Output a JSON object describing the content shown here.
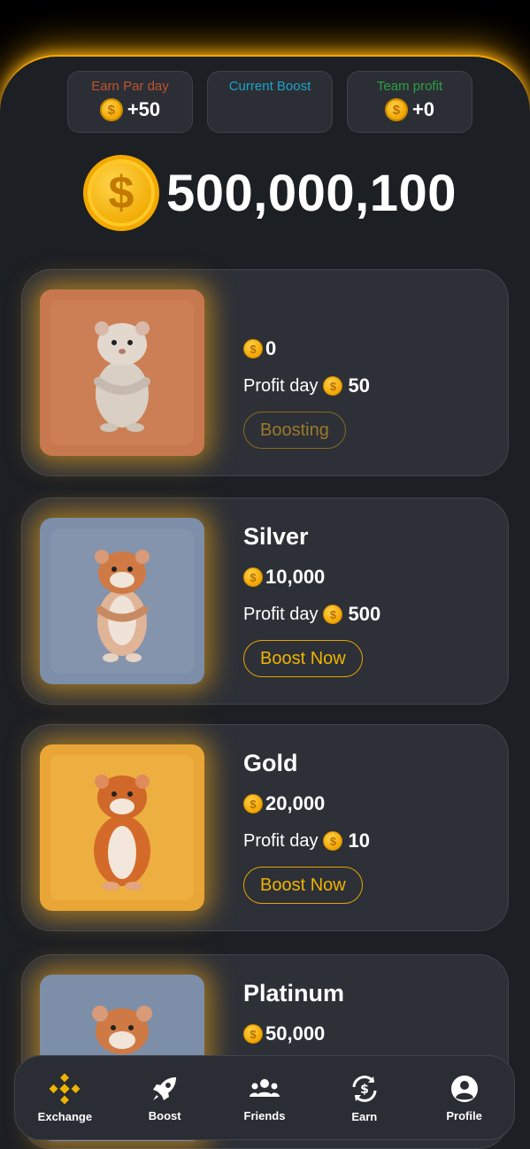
{
  "stats": [
    {
      "label": "Earn Par day",
      "value": "+50",
      "color": "#c0532e"
    },
    {
      "label": "Current Boost",
      "value": "",
      "color": "#1ba3c9"
    },
    {
      "label": "Team profit",
      "value": "+0",
      "color": "#2f9e44"
    }
  ],
  "balance": {
    "value": "500,000,100"
  },
  "coin_symbol": "$",
  "cards": [
    {
      "title": "",
      "price": "0",
      "profit_label": "Profit day",
      "profit": "50",
      "button": "Boosting",
      "bg": "#c9764a"
    },
    {
      "title": "Silver",
      "price": "10,000",
      "profit_label": "Profit day",
      "profit": "500",
      "button": "Boost Now",
      "bg": "#7f90aa"
    },
    {
      "title": "Gold",
      "price": "20,000",
      "profit_label": "Profit day",
      "profit": "10",
      "button": "Boost Now",
      "bg": "#eaa83a"
    },
    {
      "title": "Platinum",
      "price": "50,000",
      "profit_label": "",
      "profit": "",
      "button": "",
      "bg": "#7f90aa"
    }
  ],
  "nav": [
    {
      "label": "Exchange",
      "icon": "exchange-icon",
      "active": true
    },
    {
      "label": "Boost",
      "icon": "rocket-icon"
    },
    {
      "label": "Friends",
      "icon": "friends-icon"
    },
    {
      "label": "Earn",
      "icon": "earn-icon"
    },
    {
      "label": "Profile",
      "icon": "profile-icon"
    }
  ],
  "colors": {
    "accent": "#f0b400",
    "panel": "#1c1f24",
    "card": "#2d3037",
    "glow": "#f5a500"
  }
}
